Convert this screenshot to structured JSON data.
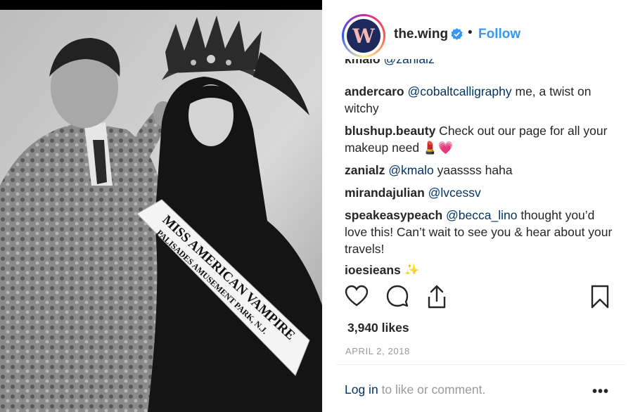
{
  "post": {
    "username": "the.wing",
    "avatar_letter": "W",
    "separator": "•",
    "follow_label": "Follow",
    "likes": "3,940 likes",
    "date": "APRIL 2, 2018",
    "login_link": "Log in",
    "login_suffix": " to like or comment.",
    "more_label": "•••"
  },
  "photo": {
    "sash_line1": "MISS AMERICAN VAMPIRE",
    "sash_line2": "PALISADES AMUSEMENT PARK, N.J."
  },
  "comments": [
    {
      "user": "kmalo",
      "mention": "@zanialz",
      "text": ""
    },
    {
      "user": "andercaro",
      "mention": "@cobaltcalligraphy",
      "text": " me, a twist on witchy"
    },
    {
      "user": "blushup.beauty",
      "mention": "",
      "text": " Check out our page for all your makeup need 💄💗"
    },
    {
      "user": "zanialz",
      "mention": "@kmalo",
      "text": " yaassss haha"
    },
    {
      "user": "mirandajulian",
      "mention": "@lvcessv",
      "text": ""
    },
    {
      "user": "speakeasypeach",
      "mention": "@becca_lino",
      "text": " thought you’d love this! Can’t wait to see you & hear about your travels!"
    },
    {
      "user": "joesjeans",
      "mention": "",
      "text": " ✨"
    }
  ],
  "icons": [
    "verified-icon",
    "heart-icon",
    "comment-icon",
    "share-icon",
    "bookmark-icon"
  ],
  "colors": {
    "accent": "#3897f0",
    "mention": "#003569",
    "muted": "#999999",
    "avatar_bg": "#1e2a5e"
  }
}
